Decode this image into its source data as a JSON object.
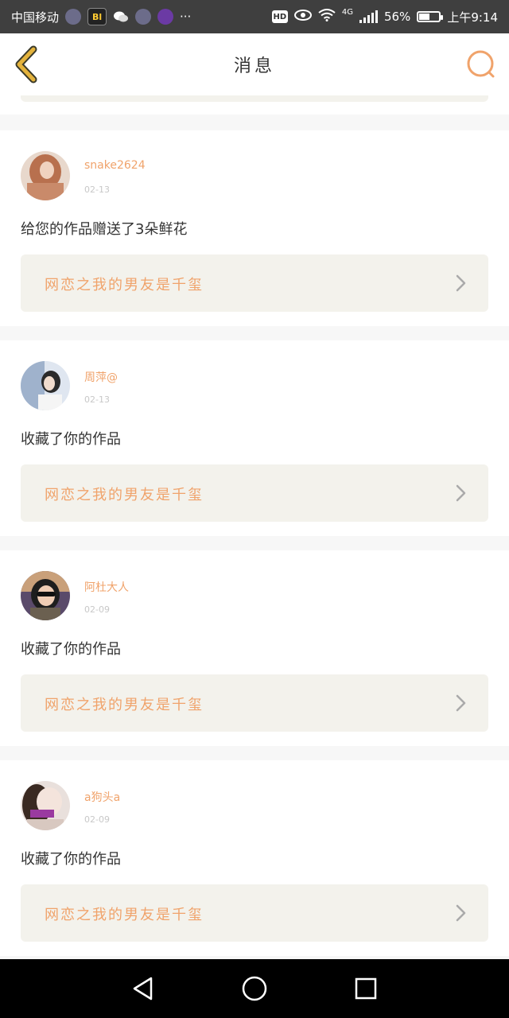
{
  "status_bar": {
    "carrier": "中国移动",
    "icons": [
      "app-icon",
      "b-app-icon",
      "wechat-icon",
      "app-icon",
      "purple-app-icon",
      "more-icon"
    ],
    "more": "···",
    "hd": "HD",
    "network": "4G",
    "battery": "56%",
    "battery_level": 0.56,
    "time": "上午9:14"
  },
  "header": {
    "title": "消息",
    "back_icon": "back-chevron-icon",
    "search_icon": "search-icon"
  },
  "messages": [
    {
      "username": "snake2624",
      "date": "02-13",
      "action": "给您的作品赠送了3朵鲜花",
      "work_title": "网恋之我的男友是千玺",
      "avatar_color": "#c98a6a"
    },
    {
      "username": "周萍@",
      "date": "02-13",
      "action": "收藏了你的作品",
      "work_title": "网恋之我的男友是千玺",
      "avatar_color": "#8aa0c0"
    },
    {
      "username": "阿杜大人",
      "date": "02-09",
      "action": "收藏了你的作品",
      "work_title": "网恋之我的男友是千玺",
      "avatar_color": "#7a5a4a"
    },
    {
      "username": "a狗头a",
      "date": "02-09",
      "action": "收藏了你的作品",
      "work_title": "网恋之我的男友是千玺",
      "avatar_color": "#b9a8a8"
    }
  ],
  "colors": {
    "accent": "#f0a36b",
    "card_bg": "#f3f2ec",
    "back_arrow": "#e3b23c"
  },
  "nav": {
    "back": "nav-back-icon",
    "home": "nav-home-icon",
    "recent": "nav-recent-icon"
  }
}
